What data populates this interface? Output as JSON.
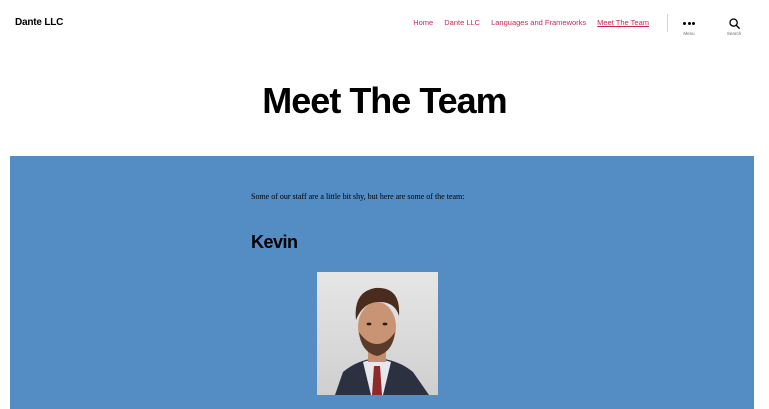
{
  "header": {
    "site_title": "Dante LLC",
    "nav": [
      {
        "label": "Home"
      },
      {
        "label": "Dante LLC"
      },
      {
        "label": "Languages and Frameworks"
      },
      {
        "label": "Meet The Team",
        "current": true
      }
    ],
    "menu_label": "Menu",
    "search_label": "Search",
    "icons": {
      "menu": "ellipsis-icon",
      "search": "search-icon"
    }
  },
  "page": {
    "title": "Meet The Team"
  },
  "content": {
    "background": "#548cc4",
    "intro": "Some of our staff are a little bit shy, but here are some of the team:",
    "members": [
      {
        "name": "Kevin"
      }
    ]
  },
  "colors": {
    "accent": "#cd2653"
  }
}
